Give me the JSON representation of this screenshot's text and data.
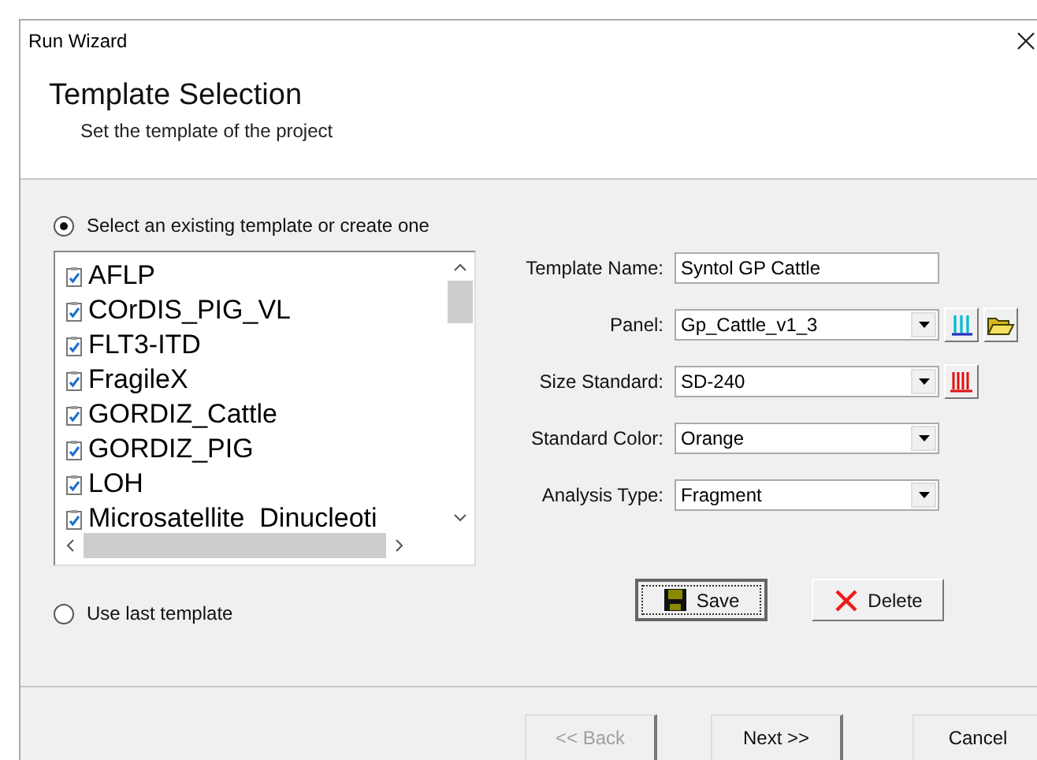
{
  "window": {
    "title": "Run Wizard"
  },
  "header": {
    "title": "Template Selection",
    "subtitle": "Set the template of the project"
  },
  "options": [
    {
      "label": "Select an existing template or create one",
      "selected": true
    },
    {
      "label": "Use last template",
      "selected": false
    }
  ],
  "templates": [
    {
      "name": "AFLP"
    },
    {
      "name": "COrDIS_PIG_VL"
    },
    {
      "name": "FLT3-ITD"
    },
    {
      "name": "FragileX"
    },
    {
      "name": "GORDIZ_Cattle"
    },
    {
      "name": "GORDIZ_PIG"
    },
    {
      "name": "LOH"
    },
    {
      "name": "Microsatellite_Dinucleoti"
    }
  ],
  "form": [
    {
      "label": "Template Name:",
      "kind": "text",
      "value": "Syntol GP Cattle"
    },
    {
      "label": "Panel:",
      "kind": "combo",
      "value": "Gp_Cattle_v1_3"
    },
    {
      "label": "Size Standard:",
      "kind": "combo",
      "value": "SD-240"
    },
    {
      "label": "Standard Color:",
      "kind": "combo",
      "value": "Orange"
    },
    {
      "label": "Analysis Type:",
      "kind": "combo",
      "value": "Fragment"
    }
  ],
  "actions": [
    {
      "label": "Save",
      "focused": true
    },
    {
      "label": "Delete",
      "focused": false
    }
  ],
  "nav": [
    {
      "label": "<< Back",
      "disabled": true
    },
    {
      "label": "Next >>",
      "disabled": false
    },
    {
      "label": "Cancel",
      "disabled": false
    }
  ]
}
